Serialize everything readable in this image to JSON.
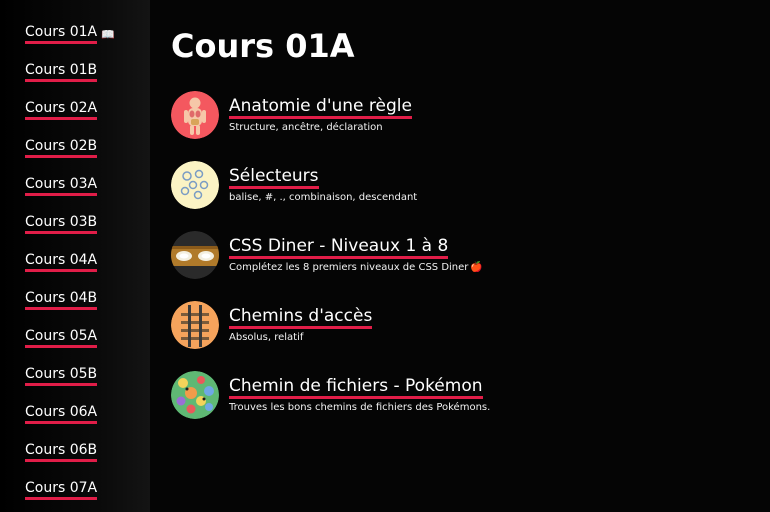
{
  "sidebar": {
    "items": [
      {
        "label": "Cours 01A",
        "icon": "book-open-icon",
        "icon_glyph": "📖"
      },
      {
        "label": "Cours 01B"
      },
      {
        "label": "Cours 02A"
      },
      {
        "label": "Cours 02B"
      },
      {
        "label": "Cours 03A"
      },
      {
        "label": "Cours 03B"
      },
      {
        "label": "Cours 04A"
      },
      {
        "label": "Cours 04B"
      },
      {
        "label": "Cours 05A"
      },
      {
        "label": "Cours 05B"
      },
      {
        "label": "Cours 06A"
      },
      {
        "label": "Cours 06B"
      },
      {
        "label": "Cours 07A"
      }
    ]
  },
  "main": {
    "title": "Cours 01A",
    "courses": [
      {
        "title": "Anatomie d'une règle",
        "description": "Structure, ancêtre, déclaration",
        "icon": "anatomy-icon"
      },
      {
        "title": "Sélecteurs",
        "description": "balise, #, ., combinaison, descendant",
        "icon": "selectors-icon"
      },
      {
        "title": "CSS Diner - Niveaux 1 à 8",
        "description": "Complétez les 8 premiers niveaux de CSS Diner",
        "description_glyph": "🍎",
        "icon": "css-diner-icon"
      },
      {
        "title": "Chemins d'accès",
        "description": "Absolus, relatif",
        "icon": "railroad-icon"
      },
      {
        "title": "Chemin de fichiers - Pokémon",
        "description": "Trouves les bons chemins de fichiers des Pokémons.",
        "icon": "pokemon-icon"
      }
    ]
  },
  "colors": {
    "accent_underline": "#e11d48",
    "background": "#050505",
    "text": "#ffffff"
  }
}
